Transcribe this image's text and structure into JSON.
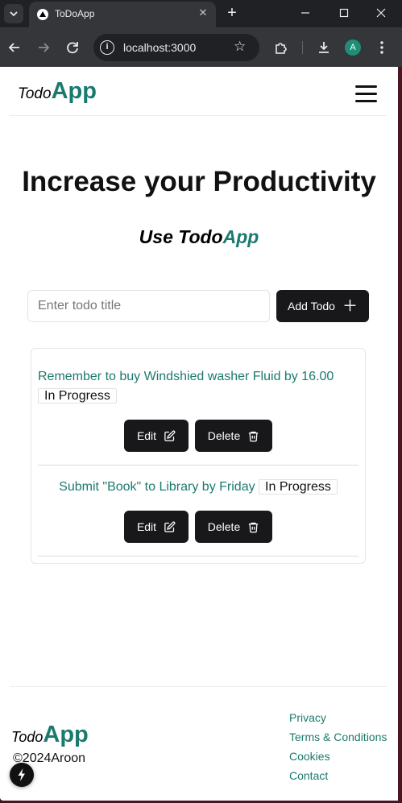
{
  "browser": {
    "tab_title": "ToDoApp",
    "url": "localhost:3000",
    "profile_initial": "A"
  },
  "header": {
    "logo_todo": "Todo",
    "logo_app": "App"
  },
  "hero": {
    "title": "Increase your Productivity",
    "subtitle_use": "Use ",
    "subtitle_todo": "Todo",
    "subtitle_app": "App"
  },
  "form": {
    "placeholder": "Enter todo title",
    "add_label": "Add Todo"
  },
  "todos": [
    {
      "title": "Remember to buy Windshied washer Fluid by 16.00",
      "status": "In Progress",
      "edit_label": "Edit",
      "delete_label": "Delete"
    },
    {
      "title": "Submit \"Book\" to Library by Friday",
      "status": "In Progress",
      "edit_label": "Edit",
      "delete_label": "Delete"
    }
  ],
  "footer": {
    "logo_todo": "Todo",
    "logo_app": "App",
    "copyright": "©2024Aroon",
    "links": [
      "Privacy",
      "Terms & Conditions",
      "Cookies",
      "Contact"
    ]
  },
  "colors": {
    "accent": "#1b7a6e",
    "button": "#18181b"
  }
}
